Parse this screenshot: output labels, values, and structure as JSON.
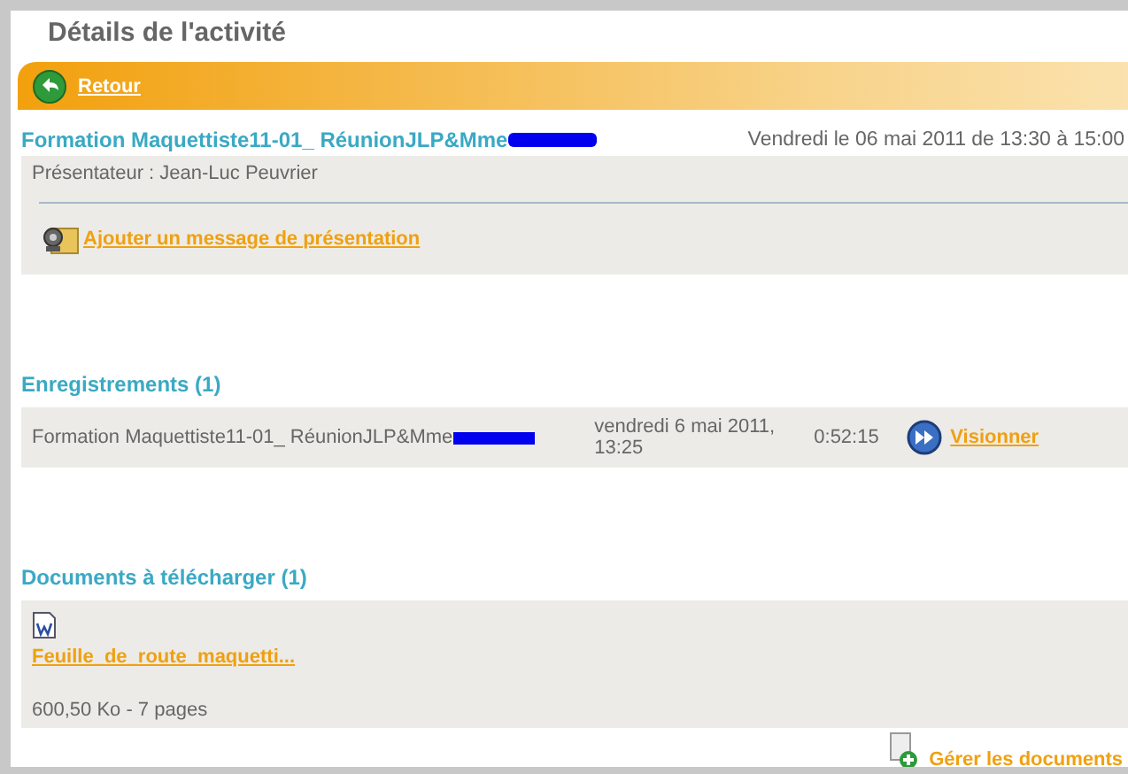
{
  "page": {
    "title": "Détails de l'activité"
  },
  "back_link": {
    "label": "Retour"
  },
  "activity": {
    "title": "Formation Maquettiste11-01_ RéunionJLP&Mme",
    "redacted": true,
    "schedule": "Vendredi le 06 mai 2011 de 13:30 à 15:00",
    "presenter": "Présentateur : Jean-Luc Peuvrier",
    "add_message_link": "Ajouter un message de présentation"
  },
  "recordings": {
    "heading": "Enregistrements (1)",
    "rows": [
      {
        "name": "Formation Maquettiste11-01_ RéunionJLP&Mme",
        "redacted": true,
        "date": "vendredi 6 mai 2011, 13:25",
        "duration": "0:52:15",
        "action": "Visionner"
      }
    ]
  },
  "documents": {
    "heading": "Documents à télécharger (1)",
    "items": [
      {
        "name": "Feuille_de_route_maquetti...",
        "info": "600,50 Ko - 7 pages"
      }
    ],
    "manage_link": "Gérer les documents"
  }
}
